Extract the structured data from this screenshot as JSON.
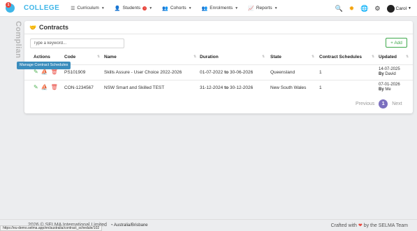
{
  "nav": {
    "notif_count": "1",
    "brand": "COLLEGE",
    "items": [
      {
        "label": "Curriculum",
        "icon": "list-icon"
      },
      {
        "label": "Students",
        "icon": "user-icon"
      },
      {
        "label": "Cohorts",
        "icon": "users-icon"
      },
      {
        "label": "Enrolments",
        "icon": "group-icon"
      },
      {
        "label": "Reports",
        "icon": "chart-icon"
      }
    ],
    "user": "Carol"
  },
  "side_text": "Complian",
  "card": {
    "title": "Contracts",
    "search_placeholder": "Type a keyword...",
    "add_label": "+ Add",
    "headers": [
      "Actions",
      "Code",
      "Name",
      "Duration",
      "State",
      "Contract Schedules",
      "Updated"
    ],
    "rows": [
      {
        "code": "PS101909",
        "name": "Skills Assure - User Choice 2022-2026",
        "from": "01-07-2022",
        "to_word": "to",
        "to": "30-06-2026",
        "state": "Queensland",
        "schedules": "1",
        "updated_date": "14-07-2025",
        "by_word": "By",
        "updated_by": "David"
      },
      {
        "code": "CON-1234567",
        "name": "NSW Smart and Skilled TEST",
        "from": "31-12-2024",
        "to_word": "to",
        "to": "30-12-2026",
        "state": "New South Wales",
        "schedules": "1",
        "updated_date": "07-01-2026",
        "by_word": "By",
        "updated_by": "Me"
      }
    ],
    "tooltip": "Manage Contract Schedules",
    "pager": {
      "prev": "Previous",
      "page": "1",
      "next": "Next"
    }
  },
  "footer": {
    "copyright": "2026 © SELMA International Limited",
    "timezone": "Australia/Brisbane",
    "crafted": "Crafted with",
    "by": "by the SELMA Team"
  },
  "status_url": "https://eu-demo.selma.app/en/australia/contract_schedule/102"
}
